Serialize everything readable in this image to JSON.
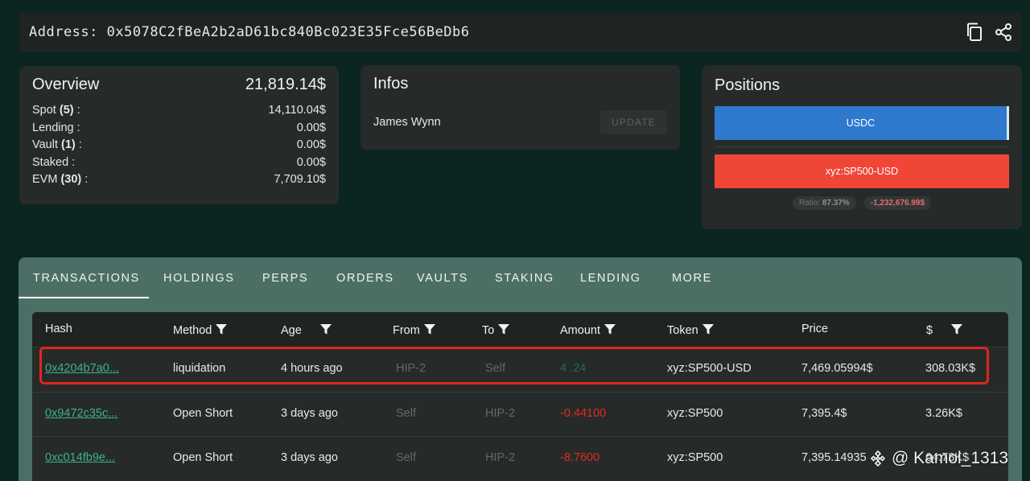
{
  "address": {
    "label": "Address:",
    "value": "0x5078C2fBeA2b2aD61bc840Bc023E35Fce56BeDb6"
  },
  "overview": {
    "title": "Overview",
    "total": "21,819.14$",
    "rows": [
      {
        "label": "Spot",
        "count": "(5)",
        "suffix": " :",
        "value": "14,110.04$"
      },
      {
        "label": "Lending",
        "count": "",
        "suffix": " :",
        "value": "0.00$"
      },
      {
        "label": "Vault",
        "count": "(1)",
        "suffix": " :",
        "value": "0.00$"
      },
      {
        "label": "Staked",
        "count": "",
        "suffix": " :",
        "value": "0.00$"
      },
      {
        "label": "EVM",
        "count": "(30)",
        "suffix": " :",
        "value": "7,709.10$"
      }
    ]
  },
  "infos": {
    "title": "Infos",
    "name": "James Wynn",
    "update_label": "UPDATE"
  },
  "positions": {
    "title": "Positions",
    "long_label": "USDC",
    "short_label": "xyz:SP500-USD",
    "ratio_label": "Ratio:",
    "ratio_value": "87.37%",
    "pnl": "-1,232,676.99$"
  },
  "tabs": [
    "TRANSACTIONS",
    "HOLDINGS",
    "PERPS",
    "ORDERS",
    "VAULTS",
    "STAKING",
    "LENDING",
    "MORE"
  ],
  "table": {
    "columns": [
      "Hash",
      "Method",
      "Age",
      "From",
      "To",
      "Amount",
      "Token",
      "Price",
      "$"
    ],
    "rows": [
      {
        "hash": "0x4204b7a0...",
        "method": "liquidation",
        "age": "4 hours ago",
        "from": "HIP-2",
        "to": "Self",
        "amount": "4 .24",
        "token": "xyz:SP500-USD",
        "price": "7,469.05994$",
        "usd": "308.03K$"
      },
      {
        "hash": "0x9472c35c...",
        "method": "Open Short",
        "age": "3 days ago",
        "from": "Self",
        "to": "HIP-2",
        "amount": "-0.44100",
        "token": "xyz:SP500",
        "price": "7,395.4$",
        "usd": "3.26K$"
      },
      {
        "hash": "0xc014fb9e...",
        "method": "Open Short",
        "age": "3 days ago",
        "from": "Self",
        "to": "HIP-2",
        "amount": "-8.7600",
        "token": "xyz:SP500",
        "price": "7,395.14935",
        "usd": "64.78K$"
      }
    ]
  },
  "watermark": "@ Kamol_1313",
  "colors": {
    "background": "#0b2520",
    "card": "#262b2a",
    "tab_bar": "#4c6f65",
    "long": "#2f79cf",
    "short": "#f04638",
    "hash_link": "#3fb08d",
    "negative": "#e2281b",
    "highlight": "#e0261c"
  }
}
